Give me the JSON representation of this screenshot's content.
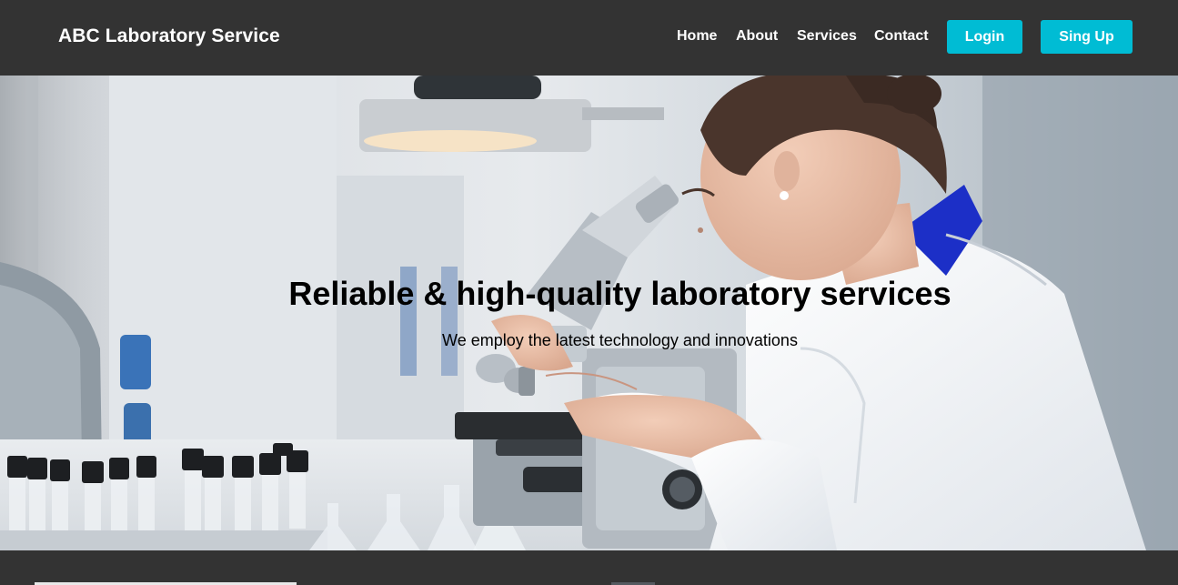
{
  "header": {
    "brand": "ABC Laboratory Service",
    "nav": [
      "Home",
      "About",
      "Services",
      "Contact"
    ],
    "login_label": "Login",
    "signup_label": "Sing Up"
  },
  "hero": {
    "title": "Reliable & high-quality laboratory services",
    "subtitle": "We employ the latest technology and innovations"
  },
  "colors": {
    "navbar_bg": "#333333",
    "accent": "#00bcd4",
    "text_light": "#ffffff",
    "hero_text": "#000000"
  }
}
